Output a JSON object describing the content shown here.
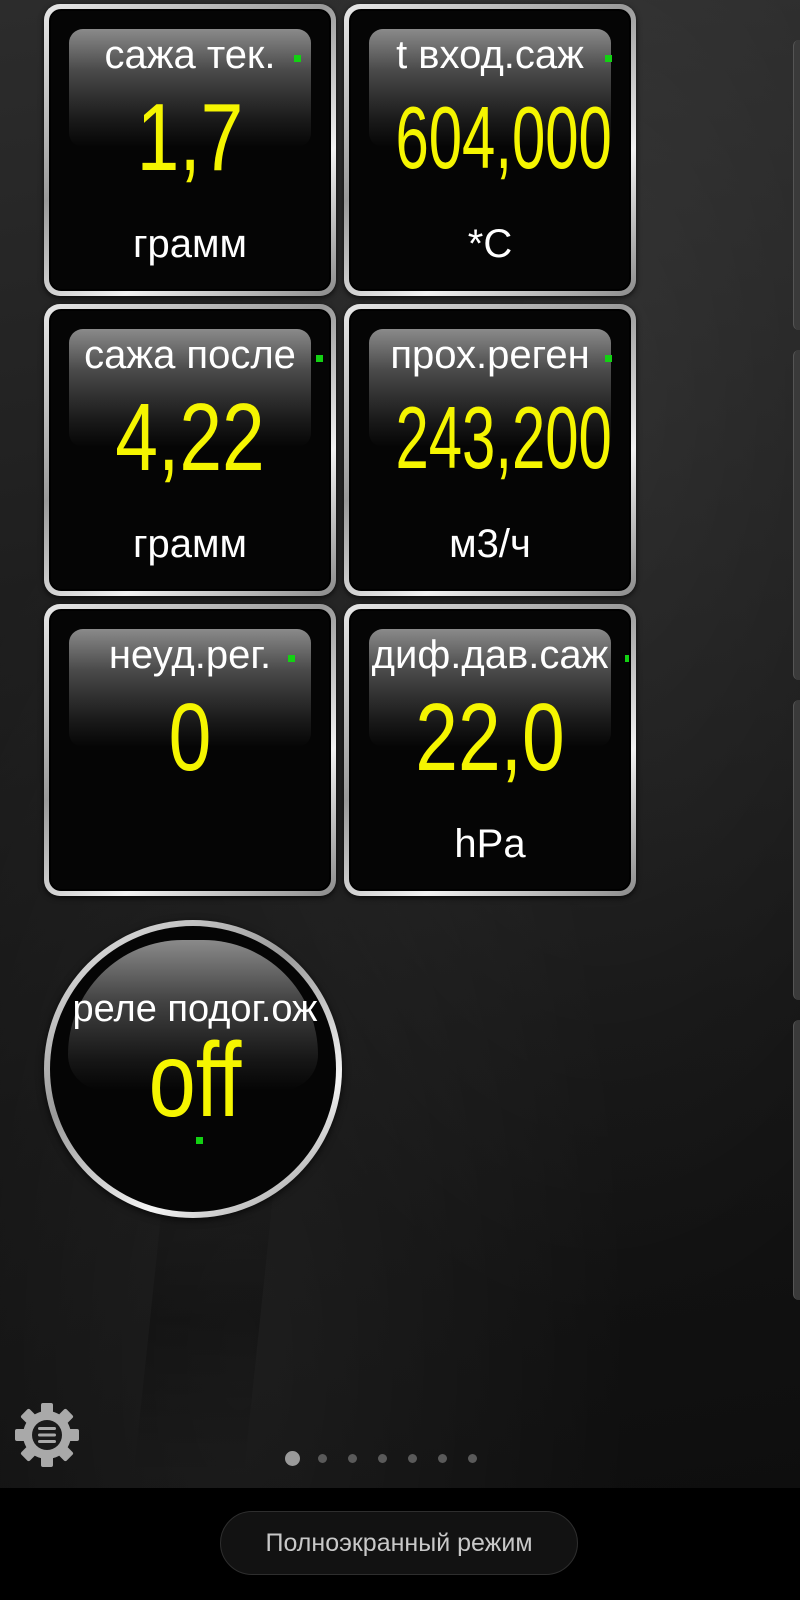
{
  "colors": {
    "value": "#f5f500",
    "label": "#ffffff",
    "indicator": "#13d113",
    "bezel": "#c0c0c0"
  },
  "gauges": [
    {
      "title": "сажа тек.",
      "value": "1,7",
      "unit": "грамм"
    },
    {
      "title": "t вход.саж",
      "value": "604,000",
      "unit": "*C"
    },
    {
      "title": "сажа после",
      "value": "4,22",
      "unit": "грамм"
    },
    {
      "title": "прох.реген",
      "value": "243,200",
      "unit": "м3/ч"
    },
    {
      "title": "неуд.рег.",
      "value": "0",
      "unit": ""
    },
    {
      "title": "диф.дав.саж",
      "value": "22,0",
      "unit": "hPa"
    }
  ],
  "round_gauge": {
    "title": "реле подог.ож",
    "value": "off"
  },
  "settings": {
    "icon": "gear-icon"
  },
  "pager": {
    "pages": 7,
    "active_page": 1
  },
  "fullscreen_button": {
    "label": "Полноэкранный режим"
  }
}
